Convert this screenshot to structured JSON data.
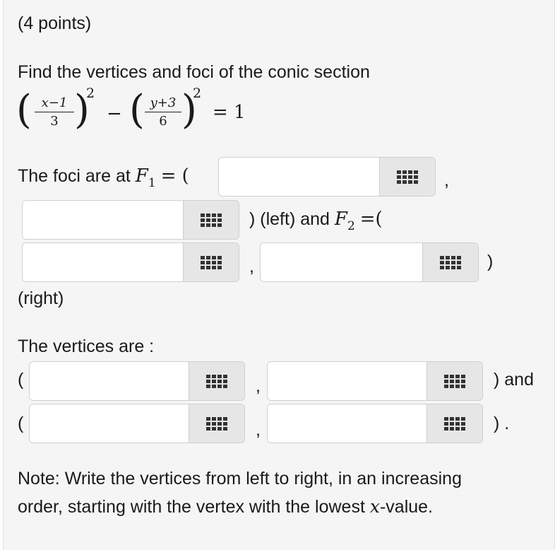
{
  "points": "(4 points)",
  "question": "Find the vertices and foci of the conic section",
  "equation": {
    "term1_num": "x−1",
    "term1_den": "3",
    "term2_num": "y+3",
    "term2_den": "6",
    "exponent": "2",
    "minus": "−",
    "rhs": "= 1"
  },
  "foci": {
    "intro": "The foci are at",
    "F": "F",
    "sub1": "1",
    "sub2": "2",
    "eq_open": "= (",
    "comma": ",",
    "left_text": ") (left) and",
    "eq_open2": "=(",
    "close": ")",
    "right_text": "(right)"
  },
  "vertices": {
    "intro": "The vertices are :",
    "open": "(",
    "comma": ",",
    "and_text": ") and",
    "end_text": ") ."
  },
  "note_line1": "Note: Write the vertices from left to right, in an increasing",
  "note_line2_pre": "order, starting with the vertex with the lowest",
  "note_var": "x",
  "note_line2_post": "-value.",
  "inputs": {
    "f1x": "",
    "f1y": "",
    "f2x": "",
    "f2y": "",
    "v1x": "",
    "v1y": "",
    "v2x": "",
    "v2y": ""
  },
  "icons": {
    "keypad": "keypad-grid-icon"
  }
}
